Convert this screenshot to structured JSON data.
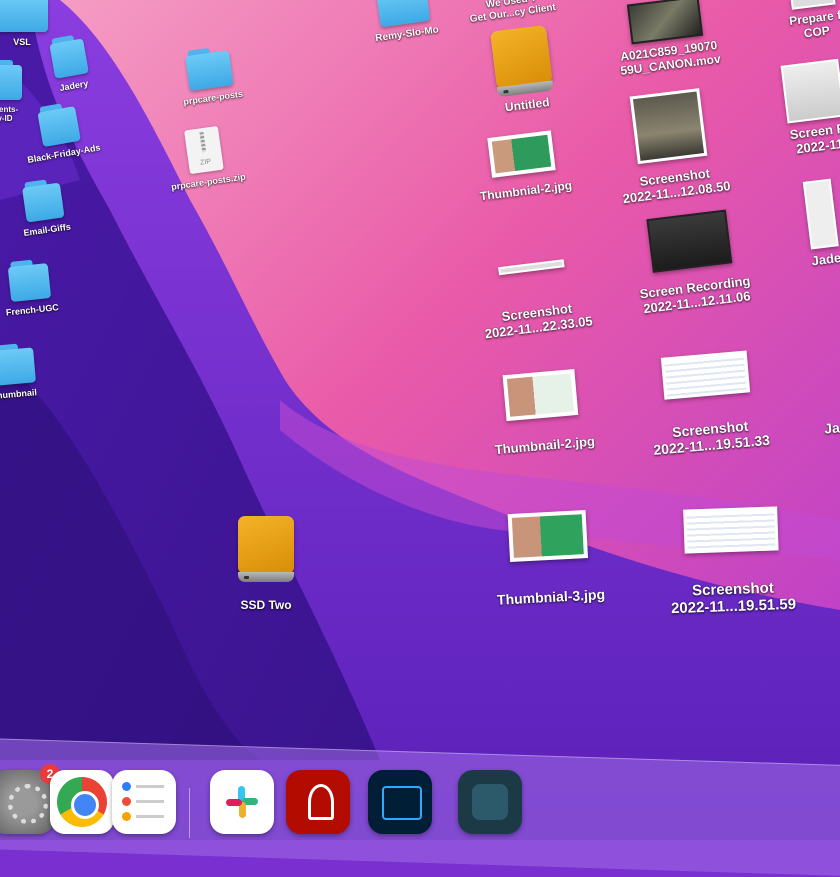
{
  "desktop": {
    "items": [
      {
        "label": "VSL"
      },
      {
        "label": "Jadery"
      },
      {
        "label": "ments-\ny-ID"
      },
      {
        "label": "Black-Friday-Ads"
      },
      {
        "label": "Email-Giffs"
      },
      {
        "label": "French-UGC"
      },
      {
        "label": "humbnail"
      },
      {
        "label": "prpcare-posts"
      },
      {
        "label": "prpcare-posts.zip"
      },
      {
        "label": "Remy-Slo-Mo"
      },
      {
        "label": "We Used T\nGet Our...cy Client"
      },
      {
        "label": "Untitled"
      },
      {
        "label": "A021C859_19070\n59U_CANON.mov"
      },
      {
        "label": "Prepare f\nCOP"
      },
      {
        "label": "Thumbnial-2.jpg"
      },
      {
        "label": "Screenshot\n2022-11...12.08.50"
      },
      {
        "label": "Screen R\n2022-11"
      },
      {
        "label": "Screenshot\n2022-11...22.33.05"
      },
      {
        "label": "Screen Recording\n2022-11...12.11.06"
      },
      {
        "label": "Jade"
      },
      {
        "label": "Thumbnail-2.jpg"
      },
      {
        "label": "Screenshot\n2022-11...19.51.33"
      },
      {
        "label": "Ja"
      },
      {
        "label": "SSD Two"
      },
      {
        "label": "Thumbnial-3.jpg"
      },
      {
        "label": "Screenshot\n2022-11...19.51.59"
      }
    ],
    "zip_tag": "ZIP"
  },
  "dock": {
    "settings_badge": "2",
    "apps": [
      {
        "name": "System Settings"
      },
      {
        "name": "Chrome"
      },
      {
        "name": "Reminders"
      },
      {
        "name": "Slack"
      },
      {
        "name": "Acrobat"
      },
      {
        "name": "Photoshop"
      },
      {
        "name": "App"
      }
    ]
  },
  "colors": {
    "accent": "#e93b3b",
    "folder": "#5bbcf2",
    "drive": "#f0a818"
  }
}
